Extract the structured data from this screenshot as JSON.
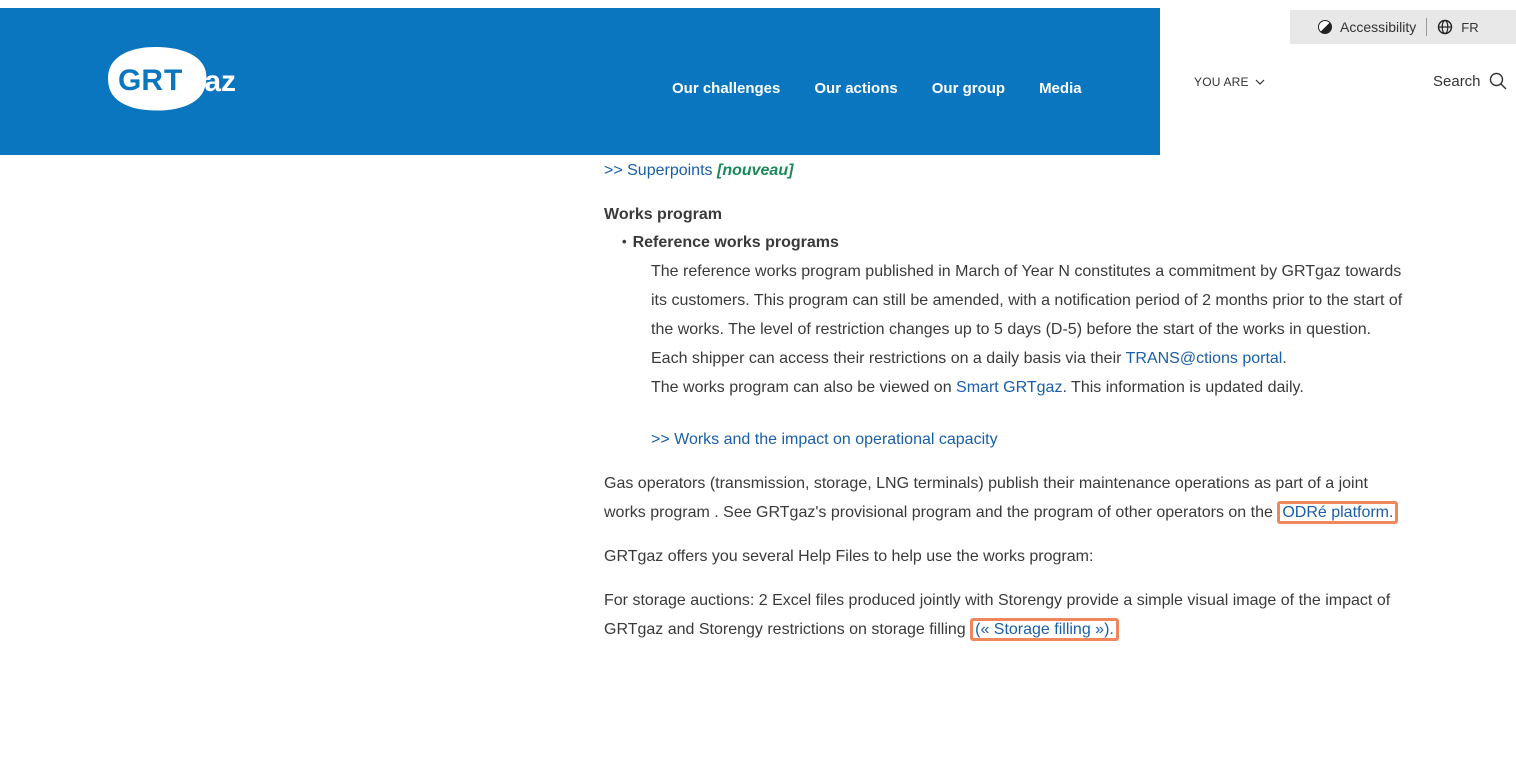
{
  "header": {
    "logo_text": "GRTgaz",
    "nav": [
      "Our challenges",
      "Our actions",
      "Our group",
      "Media"
    ],
    "you_are": "YOU ARE",
    "search": "Search",
    "accessibility": "Accessibility",
    "language": "FR"
  },
  "content": {
    "superpoints_link": ">> Superpoints",
    "new_tag": "[nouveau]",
    "works_title": "Works program",
    "ref_title": "Reference works programs",
    "ref_p1": "The reference works program published in March of Year N constitutes a commitment by GRTgaz towards its customers. This program can still be amended, with a notification period of 2 months prior to the start of the works. The level of restriction changes up to 5 days (D-5) before the start of the works in question.",
    "ref_p2_pre": "Each shipper can access their restrictions on a daily basis via their ",
    "ref_p2_link": "TRANS@ctions portal",
    "ref_p2_post": ".",
    "ref_p3_pre": "The works program  can also be viewed on ",
    "ref_p3_link": "Smart GRTgaz",
    "ref_p3_post": ". This information is updated daily.",
    "impact_link": ">> Works and the impact on operational capacity",
    "gas_p_pre": "Gas operators (transmission, storage, LNG terminals) publish their maintenance operations as part of a joint works program . See GRTgaz's provisional program and the program  of other operators on the ",
    "gas_p_link": "ODRé platform.",
    "help_p": "GRTgaz offers you several Help Files to help use the works program:",
    "storage_p_pre": "For storage auctions: 2 Excel files produced jointly with Storengy provide a simple visual image of the impact of GRTgaz and Storengy restrictions on storage filling ",
    "storage_p_link": "(« Storage filling »).",
    "storage_p_post": ""
  },
  "colors": {
    "header_blue": "#0a76bf",
    "link": "#1a5fa8",
    "highlight": "#f0875a"
  }
}
